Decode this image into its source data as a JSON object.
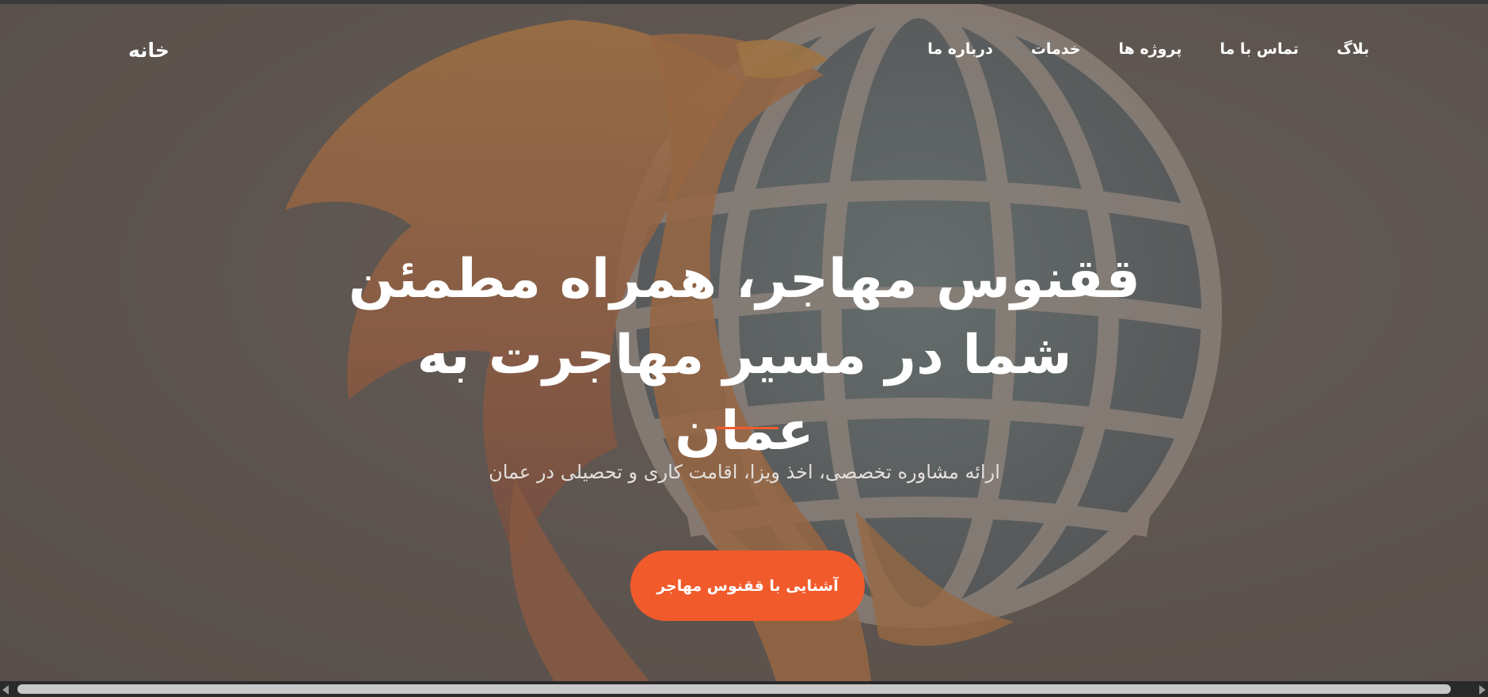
{
  "nav": {
    "logo": "خانه",
    "items": [
      {
        "label": "بلاگ"
      },
      {
        "label": "تماس با ما"
      },
      {
        "label": "پروژه ها"
      },
      {
        "label": "خدمات"
      },
      {
        "label": "درباره ما"
      }
    ]
  },
  "hero": {
    "headline_line1": "ققنوس مهاجر، همراه مطمئن",
    "headline_line2": "شما در مسیر مهاجرت به عمان",
    "subtitle": "ارائه مشاوره تخصصی، اخذ ویزا، اقامت کاری و تحصیلی در عمان",
    "cta_label": "آشنایی با ققنوس مهاجر",
    "background_icon": "phoenix-globe-illustration"
  },
  "colors": {
    "accent": "#f15a2b",
    "overlay": "#6f6661",
    "text": "#ffffff"
  }
}
